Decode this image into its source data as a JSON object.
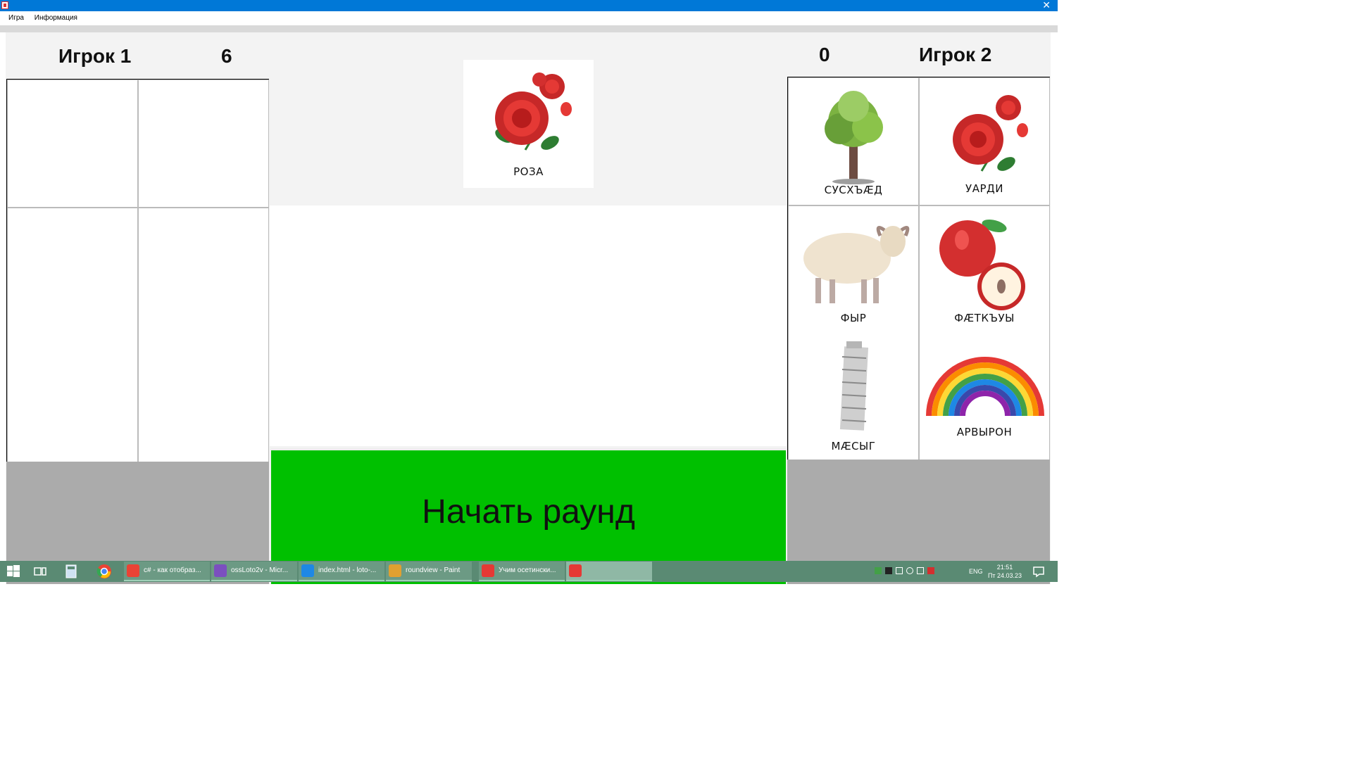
{
  "window": {
    "close_glyph": "✕"
  },
  "menu": {
    "items": [
      "Игра",
      "Информация"
    ]
  },
  "player1": {
    "name": "Игрок 1",
    "score": "6"
  },
  "player2": {
    "name": "Игрок 2",
    "score": "0"
  },
  "current_card": {
    "caption": "РОЗА",
    "icon": "rose-icon"
  },
  "player2_cards": [
    {
      "caption": "СУСХЪÆД",
      "icon": "tree-icon"
    },
    {
      "caption": "УАРДИ",
      "icon": "rose-icon"
    },
    {
      "caption": "ФЫР",
      "icon": "sheep-icon"
    },
    {
      "caption": "ФÆТКЪУЫ",
      "icon": "apple-icon"
    },
    {
      "caption": "МÆСЫГ",
      "icon": "tower-icon"
    },
    {
      "caption": "АРВЫРОН",
      "icon": "rainbow-icon"
    }
  ],
  "start_button": {
    "label": "Начать раунд"
  },
  "taskbar": {
    "apps": [
      {
        "label": "c# - как отобраз...",
        "color": "#ea4335"
      },
      {
        "label": "ossLoto2v - Micr...",
        "color": "#7b4fbf"
      },
      {
        "label": "index.html - loto-...",
        "color": "#1e88e5"
      },
      {
        "label": "roundview - Paint",
        "color": "#e0a030"
      },
      {
        "label": "Учим осетински...",
        "color": "#e53935"
      },
      {
        "label": "",
        "color": "#e53935"
      }
    ],
    "lang": "ENG",
    "time": "21:51",
    "date": "Пт 24.03.23"
  }
}
